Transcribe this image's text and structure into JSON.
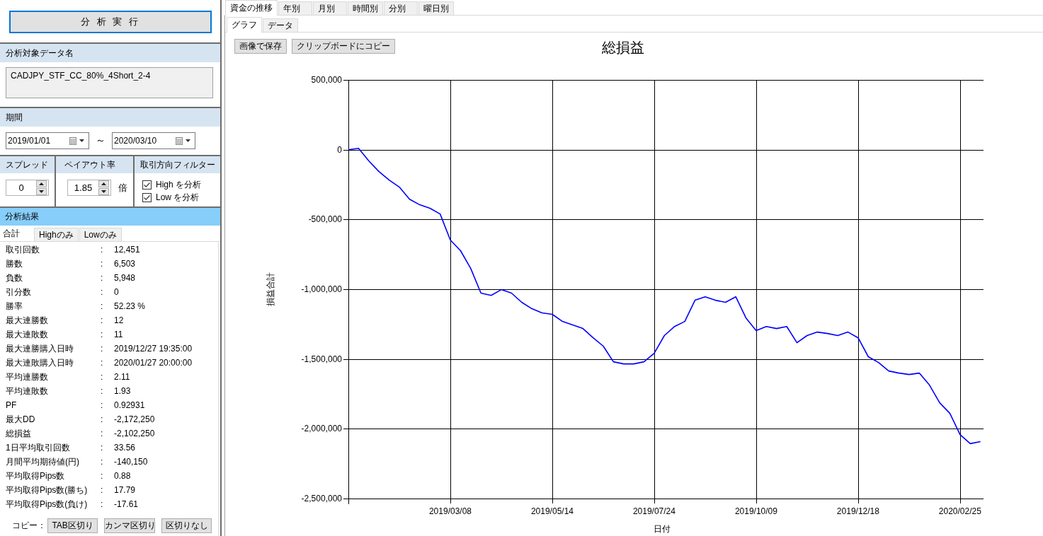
{
  "run_button": {
    "label": "分 析 実 行"
  },
  "target_data": {
    "heading": "分析対象データ名",
    "value": "CADJPY_STF_CC_80%_4Short_2-4"
  },
  "period": {
    "heading": "期間",
    "start": "2019/01/01",
    "separator": "～",
    "end": "2020/03/10"
  },
  "spread": {
    "heading": "スプレッド",
    "value": "0"
  },
  "payout": {
    "heading": "ペイアウト率",
    "value": "1.85",
    "unit": "倍"
  },
  "direction_filter": {
    "heading": "取引方向フィルター",
    "options": [
      {
        "label": "High を分析",
        "checked": true
      },
      {
        "label": "Low を分析",
        "checked": true
      }
    ]
  },
  "results": {
    "heading": "分析結果",
    "tabs": [
      {
        "label": "合計",
        "selected": true
      },
      {
        "label": "Highのみ",
        "selected": false
      },
      {
        "label": "Lowのみ",
        "selected": false
      }
    ],
    "rows": [
      {
        "label": "取引回数",
        "separator": ":",
        "value": "12,451"
      },
      {
        "label": "勝数",
        "separator": ":",
        "value": "6,503"
      },
      {
        "label": "負数",
        "separator": ":",
        "value": "5,948"
      },
      {
        "label": "引分数",
        "separator": ":",
        "value": "0"
      },
      {
        "label": "勝率",
        "separator": ":",
        "value": "52.23 %"
      },
      {
        "label": "最大連勝数",
        "separator": ":",
        "value": "12"
      },
      {
        "label": "最大連敗数",
        "separator": ":",
        "value": "11"
      },
      {
        "label": "最大連勝購入日時",
        "separator": ":",
        "value": "2019/12/27 19:35:00"
      },
      {
        "label": "最大連敗購入日時",
        "separator": ":",
        "value": "2020/01/27 20:00:00"
      },
      {
        "label": "平均連勝数",
        "separator": ":",
        "value": "2.11"
      },
      {
        "label": "平均連敗数",
        "separator": ":",
        "value": "1.93"
      },
      {
        "label": "PF",
        "separator": ":",
        "value": "0.92931"
      },
      {
        "label": "最大DD",
        "separator": ":",
        "value": "-2,172,250"
      },
      {
        "label": "総損益",
        "separator": ":",
        "value": "-2,102,250"
      },
      {
        "label": "1日平均取引回数",
        "separator": ":",
        "value": "33.56"
      },
      {
        "label": "月間平均期待値(円)",
        "separator": ":",
        "value": "-140,150"
      },
      {
        "label": "平均取得Pips数",
        "separator": ":",
        "value": "0.88"
      },
      {
        "label": "平均取得Pips数(勝ち)",
        "separator": ":",
        "value": "17.79"
      },
      {
        "label": "平均取得Pips数(負け)",
        "separator": ":",
        "value": "-17.61"
      }
    ],
    "copy": {
      "label": "コピー：",
      "buttons": [
        "TAB区切り",
        "カンマ区切り",
        "区切りなし"
      ]
    }
  },
  "main_tabs": [
    {
      "label": "資金の推移",
      "selected": true
    },
    {
      "label": "年別",
      "selected": false
    },
    {
      "label": "月別",
      "selected": false
    },
    {
      "label": "時間別",
      "selected": false
    },
    {
      "label": "分別",
      "selected": false
    },
    {
      "label": "曜日別",
      "selected": false
    }
  ],
  "sub_tabs": [
    {
      "label": "グラフ",
      "selected": true
    },
    {
      "label": "データ",
      "selected": false
    }
  ],
  "graph_panel": {
    "buttons": [
      "画像で保存",
      "クリップボードにコピー"
    ],
    "chart_data": {
      "type": "line",
      "title": "総損益",
      "xlabel": "日付",
      "ylabel": "損益合計",
      "grid": true,
      "categories": [
        null,
        null,
        null,
        null,
        null,
        null,
        null,
        null,
        null,
        null,
        "2019/03/08",
        null,
        null,
        null,
        null,
        null,
        null,
        null,
        null,
        null,
        "2019/05/14",
        null,
        null,
        null,
        null,
        null,
        null,
        null,
        null,
        null,
        "2019/07/24",
        null,
        null,
        null,
        null,
        null,
        null,
        null,
        null,
        null,
        "2019/10/09",
        null,
        null,
        null,
        null,
        null,
        null,
        null,
        null,
        null,
        "2019/12/18",
        null,
        null,
        null,
        null,
        null,
        null,
        null,
        null,
        null,
        "2020/02/25",
        null,
        null
      ],
      "series": [
        {
          "color": "#0000ff",
          "values": [
            0,
            10000,
            -80000,
            -157000,
            -218000,
            -268000,
            -355000,
            -395000,
            -420000,
            -461000,
            -648000,
            -724000,
            -851000,
            -1028000,
            -1044000,
            -1003000,
            -1028000,
            -1094000,
            -1140000,
            -1170000,
            -1180000,
            -1231000,
            -1256000,
            -1282000,
            -1348000,
            -1408000,
            -1520000,
            -1535000,
            -1535000,
            -1520000,
            -1459000,
            -1332000,
            -1267000,
            -1231000,
            -1079000,
            -1054000,
            -1079000,
            -1094000,
            -1054000,
            -1206000,
            -1297000,
            -1267000,
            -1282000,
            -1267000,
            -1383000,
            -1332000,
            -1307000,
            -1317000,
            -1332000,
            -1307000,
            -1348000,
            -1484000,
            -1525000,
            -1586000,
            -1601000,
            -1611000,
            -1601000,
            -1687000,
            -1814000,
            -1890000,
            -2042000,
            -2107000,
            -2092000
          ]
        }
      ],
      "ylim": [
        -2500000,
        500000
      ],
      "yticks": [
        {
          "value": 500000,
          "label": "500,000"
        },
        {
          "value": 0,
          "label": "0"
        },
        {
          "value": -500000,
          "label": "-500,000"
        },
        {
          "value": -1000000,
          "label": "-1,000,000"
        },
        {
          "value": -1500000,
          "label": "-1,500,000"
        },
        {
          "value": -2000000,
          "label": "-2,000,000"
        },
        {
          "value": -2500000,
          "label": "-2,500,000"
        }
      ]
    }
  }
}
